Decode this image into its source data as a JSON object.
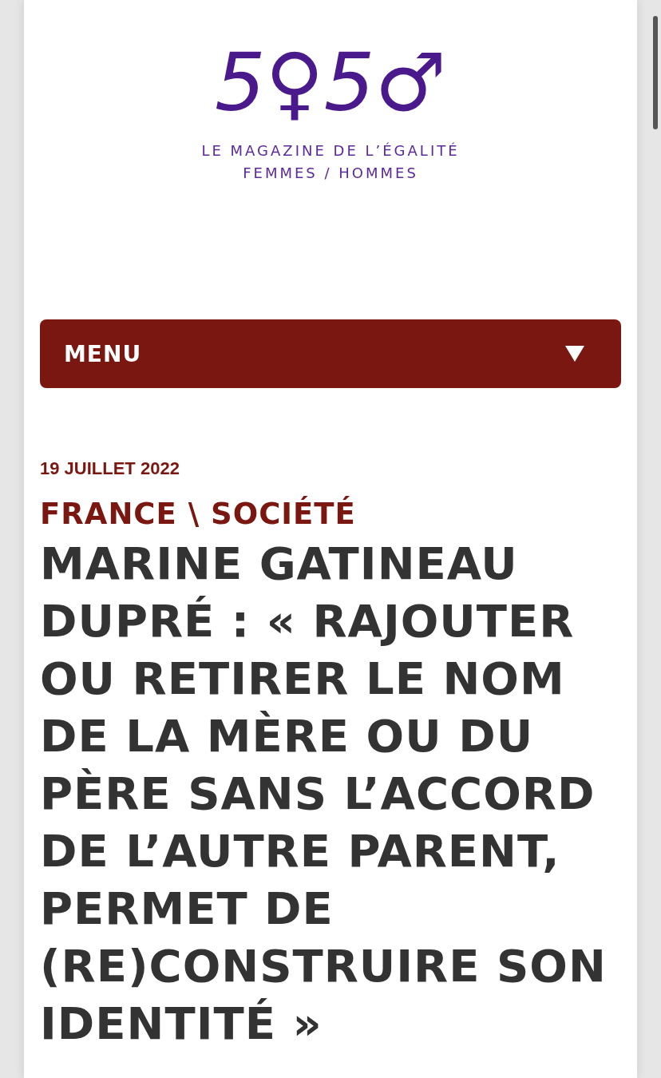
{
  "logo": {
    "text": "5♀5♂",
    "tagline_lines": [
      "LE MAGAZINE DE L’ÉGALITÉ",
      "FEMMES / HOMMES"
    ]
  },
  "menu": {
    "label": "MENU",
    "expanded": false
  },
  "article": {
    "date": "19 JUILLET 2022",
    "category": "FRANCE \\ SOCIÉTÉ",
    "title": "MARINE GATINEAU DUPRÉ : « RAJOUTER OU RETIRER LE NOM DE LA MÈRE OU DU PÈRE SANS L’ACCORD DE L’AUTRE PARENT, PERMET DE (RE)CONSTRUIRE SON IDENTITÉ »"
  }
}
